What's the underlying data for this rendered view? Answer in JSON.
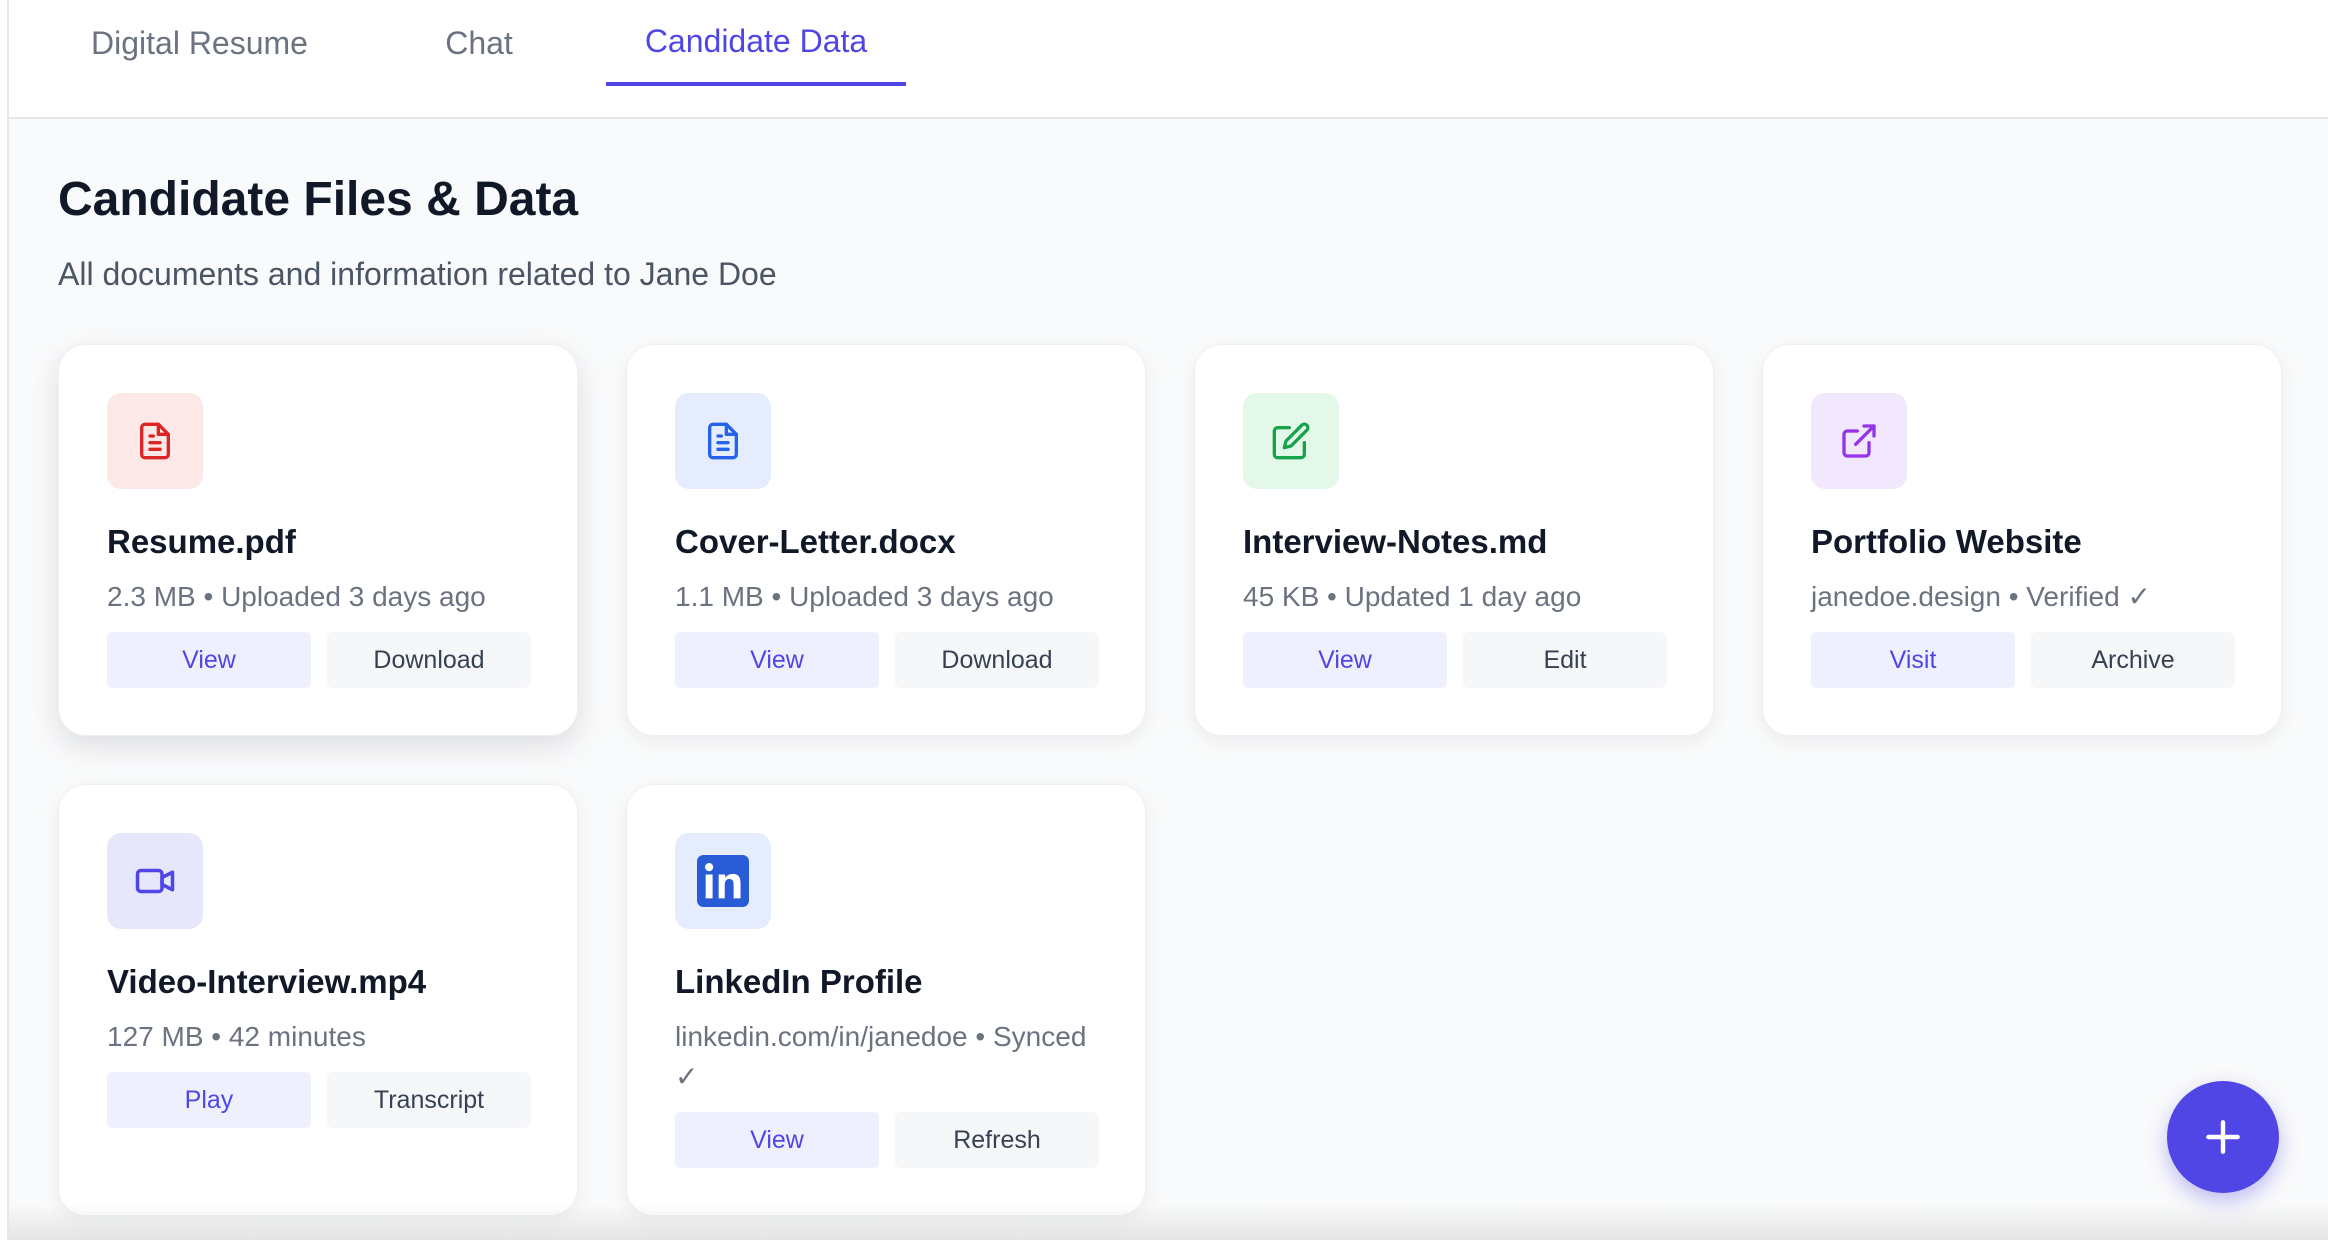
{
  "tabs": [
    {
      "label": "Digital Resume",
      "active": false
    },
    {
      "label": "Chat",
      "active": false
    },
    {
      "label": "Candidate Data",
      "active": true
    }
  ],
  "page": {
    "title": "Candidate Files & Data",
    "subtitle": "All documents and information related to Jane Doe"
  },
  "cards": [
    {
      "title": "Resume.pdf",
      "meta": "2.3 MB • Uploaded 3 days ago",
      "primary": "View",
      "secondary": "Download",
      "icon": "file-text-icon",
      "accent": "#dc2626",
      "tint": "#fde8e8"
    },
    {
      "title": "Cover-Letter.docx",
      "meta": "1.1 MB • Uploaded 3 days ago",
      "primary": "View",
      "secondary": "Download",
      "icon": "file-text-icon",
      "accent": "#2563eb",
      "tint": "#e4ecfd"
    },
    {
      "title": "Interview-Notes.md",
      "meta": "45 KB • Updated 1 day ago",
      "primary": "View",
      "secondary": "Edit",
      "icon": "edit-icon",
      "accent": "#16a34a",
      "tint": "#e3f8e8"
    },
    {
      "title": "Portfolio Website",
      "meta": "janedoe.design • Verified ✓",
      "primary": "Visit",
      "secondary": "Archive",
      "icon": "external-link-icon",
      "accent": "#9333ea",
      "tint": "#f1e8fd"
    },
    {
      "title": "Video-Interview.mp4",
      "meta": "127 MB • 42 minutes",
      "primary": "Play",
      "secondary": "Transcript",
      "icon": "video-icon",
      "accent": "#4f46e5",
      "tint": "#e6e7fb"
    },
    {
      "title": "LinkedIn Profile",
      "meta": "linkedin.com/in/janedoe • Synced ✓",
      "primary": "View",
      "secondary": "Refresh",
      "icon": "linkedin-icon",
      "accent": "#2a5bd7",
      "tint": "#e4ecfd"
    }
  ],
  "fab": {
    "icon": "plus-icon"
  },
  "colors": {
    "accent": "#4f46e5"
  }
}
